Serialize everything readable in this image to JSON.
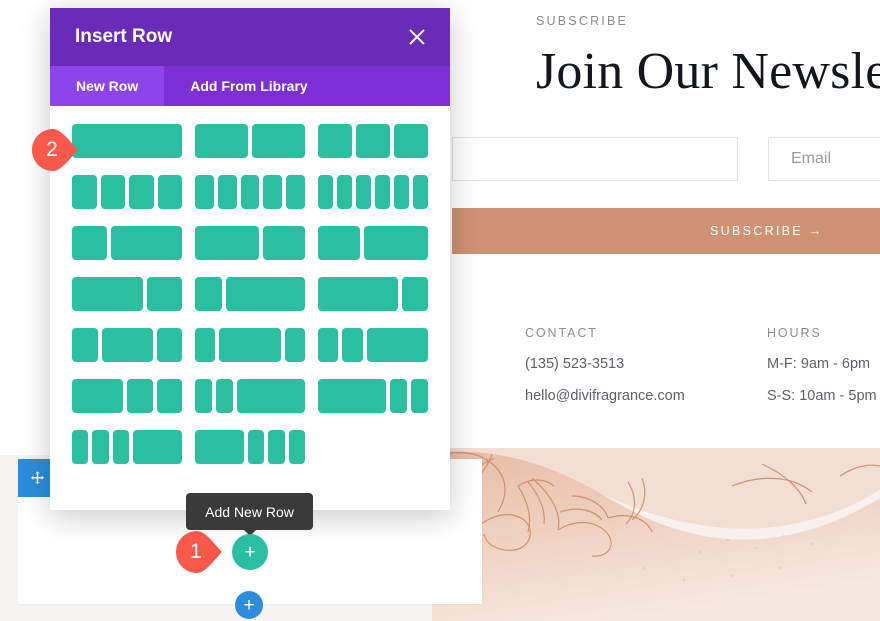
{
  "page": {
    "eyebrow": "SUBSCRIBE",
    "headline": "Join Our Newsle",
    "name_placeholder": "",
    "email_placeholder": "Email",
    "subscribe_label": "SUBSCRIBE →",
    "contact": {
      "title": "CONTACT",
      "phone": "(135) 523-3513",
      "email": "hello@divifragrance.com"
    },
    "hours": {
      "title": "HOURS",
      "weekday": "M-F: 9am - 6pm",
      "weekend": "S-S: 10am - 5pm"
    }
  },
  "editor": {
    "drag_handle_icon": "move-icon",
    "add_section_icon": "plus-icon",
    "add_row_icon": "plus-icon",
    "tooltip": "Add New Row",
    "markers": [
      {
        "label": "1",
        "color": "#f9584a"
      },
      {
        "label": "2",
        "color": "#f9584a"
      }
    ]
  },
  "modal": {
    "title": "Insert Row",
    "close_icon": "close-icon",
    "tabs": [
      {
        "label": "New Row",
        "active": true
      },
      {
        "label": "Add From Library",
        "active": false
      }
    ],
    "layouts": [
      {
        "name": "1-column",
        "cols": [
          1
        ]
      },
      {
        "name": "2-column",
        "cols": [
          1,
          1
        ]
      },
      {
        "name": "3-column",
        "cols": [
          1,
          1,
          1
        ]
      },
      {
        "name": "4-column",
        "cols": [
          1,
          1,
          1,
          1
        ]
      },
      {
        "name": "5-column",
        "cols": [
          1,
          1,
          1,
          1,
          1
        ]
      },
      {
        "name": "6-column",
        "cols": [
          1,
          1,
          1,
          1,
          1,
          1
        ]
      },
      {
        "name": "one-third-two-thirds",
        "cols": [
          1,
          2
        ]
      },
      {
        "name": "three-fifths-two-fifths",
        "cols": [
          3,
          2
        ]
      },
      {
        "name": "two-fifths-three-fifths",
        "cols": [
          2,
          3
        ]
      },
      {
        "name": "two-thirds-one-third",
        "cols": [
          2,
          1
        ]
      },
      {
        "name": "one-quarter-three-quarters",
        "cols": [
          1,
          3
        ]
      },
      {
        "name": "three-quarters-one-quarter",
        "cols": [
          3,
          1
        ]
      },
      {
        "name": "quarter-half-quarter",
        "cols": [
          1,
          2,
          1
        ]
      },
      {
        "name": "fifth-three-fifths-fifth",
        "cols": [
          1,
          3,
          1
        ]
      },
      {
        "name": "fifth-fifth-three-fifths",
        "cols": [
          1,
          1,
          3
        ]
      },
      {
        "name": "half-quarter-quarter",
        "cols": [
          2,
          1,
          1
        ]
      },
      {
        "name": "sixth-sixth-two-thirds",
        "cols": [
          1,
          1,
          4
        ]
      },
      {
        "name": "two-thirds-sixth-sixth",
        "cols": [
          4,
          1,
          1
        ]
      },
      {
        "name": "sixth-sixth-sixth-half",
        "cols": [
          1,
          1,
          1,
          3
        ]
      },
      {
        "name": "half-sixth-sixth-sixth",
        "cols": [
          3,
          1,
          1,
          1
        ]
      }
    ]
  },
  "colors": {
    "modal_header": "#6a2cb8",
    "tab_bar": "#7b2fd4",
    "tab_active": "#8e44ec",
    "layout_teal": "#2bbfa2",
    "marker_red": "#f9584a",
    "editor_blue": "#2d8ddb",
    "subscribe_peach": "#cf9272",
    "tooltip_dark": "#3a3a3a"
  }
}
